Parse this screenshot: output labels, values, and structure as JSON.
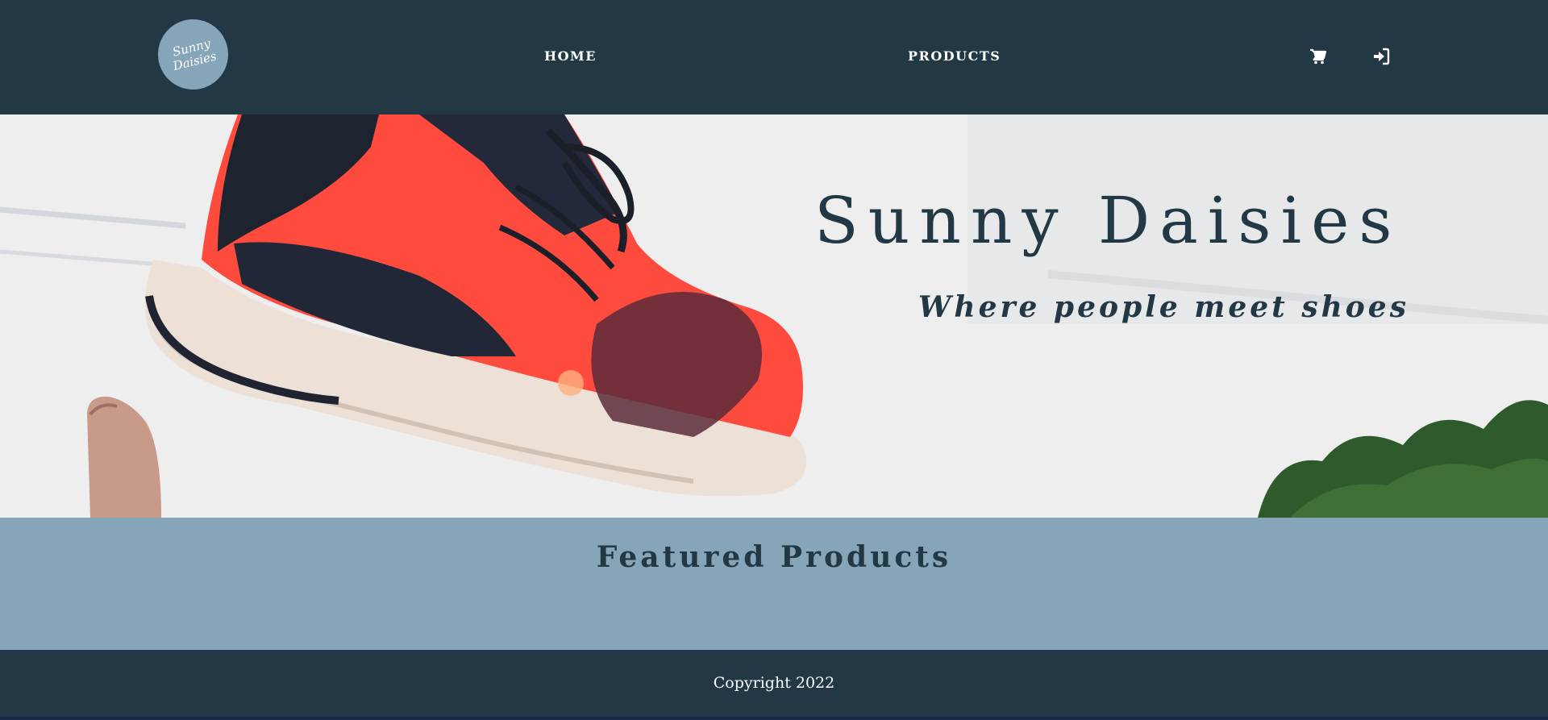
{
  "header": {
    "logo": {
      "line1": "Sunny",
      "line2": "Daisies"
    },
    "nav": {
      "home": "HOME",
      "products": "PRODUCTS"
    },
    "icons": {
      "cart": "cart-icon",
      "login": "sign-in-icon"
    }
  },
  "hero": {
    "title": "Sunny Daisies",
    "subtitle": "Where people meet shoes"
  },
  "featured": {
    "title": "Featured Products"
  },
  "footer": {
    "copyright": "Copyright 2022"
  },
  "colors": {
    "navy": "#233845",
    "slate_blue": "#86a5b8",
    "shoe_red": "#ff4b3e",
    "white": "#ffffff"
  }
}
